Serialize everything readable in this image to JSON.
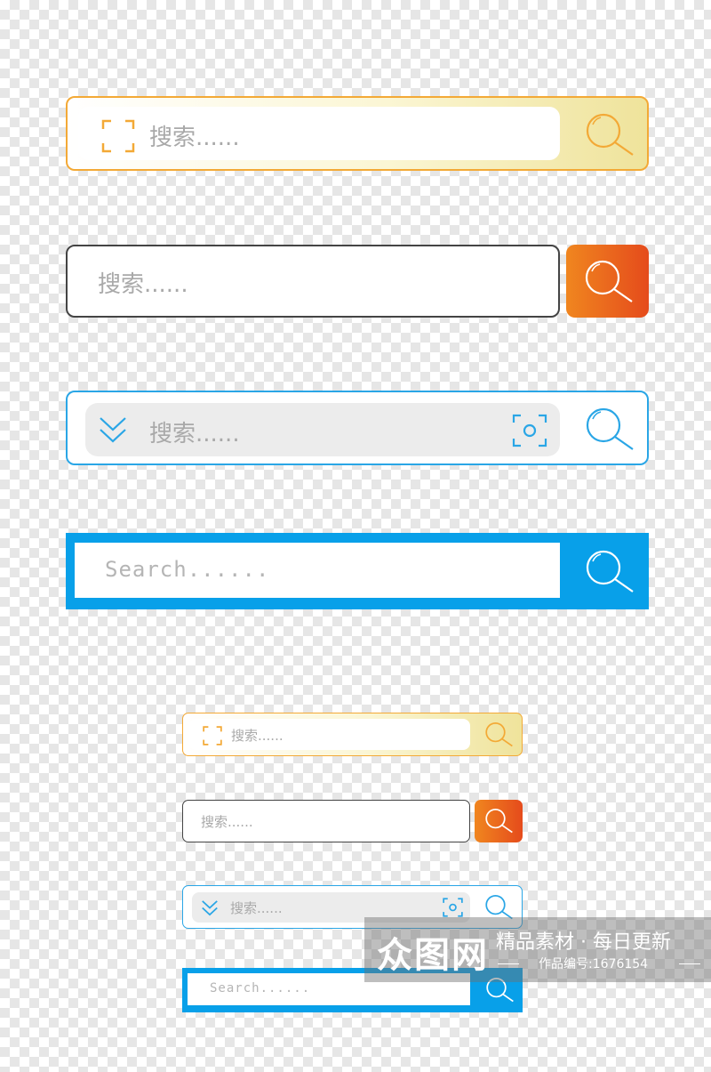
{
  "search_bars": [
    {
      "variant": "yellow-gradient",
      "placeholder": "搜索......",
      "left_icon": "scan-frame-icon",
      "button_icon": "search-icon",
      "accent": "#f3a936"
    },
    {
      "variant": "outline-orange-button",
      "placeholder": "搜索......",
      "button_icon": "search-icon",
      "accent": "#e9621e"
    },
    {
      "variant": "blue-outline",
      "placeholder": "搜索......",
      "left_icon": "double-chevron-down-icon",
      "right_icon": "camera-scan-icon",
      "button_icon": "search-icon",
      "accent": "#2aa6e6"
    },
    {
      "variant": "solid-blue",
      "placeholder": "Search......",
      "button_icon": "search-icon",
      "accent": "#08a0e9"
    }
  ],
  "watermark": {
    "logo": "众图网",
    "slogan": "精品素材 · 每日更新",
    "work_id": "作品编号:1676154"
  }
}
